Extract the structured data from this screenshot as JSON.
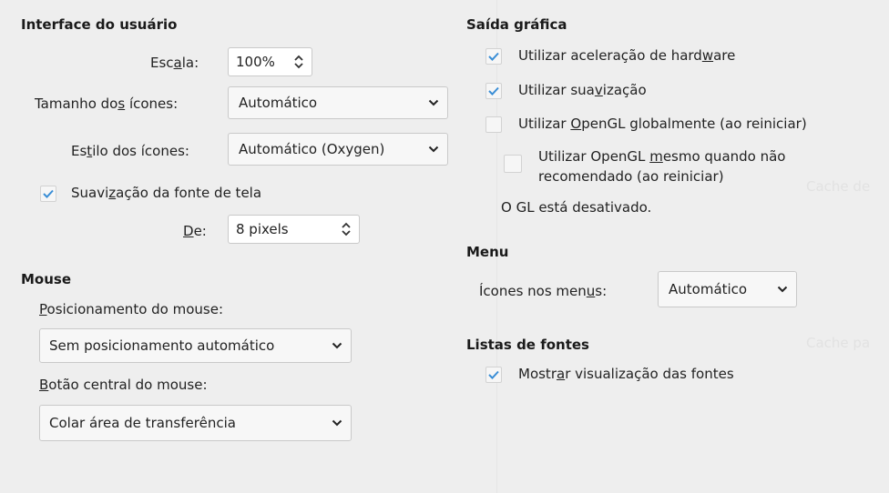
{
  "ui": {
    "title": "Interface do usuário",
    "scale_label_a": "Esc",
    "scale_label_u": "a",
    "scale_label_b": "la:",
    "scale_value": "100%",
    "icon_size_label_a": "Tamanho do",
    "icon_size_label_u": "s",
    "icon_size_label_b": " ícones:",
    "icon_size_value": "Automático",
    "icon_style_label_a": "Es",
    "icon_style_label_u": "t",
    "icon_style_label_b": "ilo dos ícones:",
    "icon_style_value": "Automático (Oxygen)",
    "smoothing_label_a": "Suavi",
    "smoothing_label_u": "z",
    "smoothing_label_b": "ação da fonte de tela",
    "from_label_u": "D",
    "from_label_b": "e:",
    "from_value": "8 pixels"
  },
  "mouse": {
    "title": "Mouse",
    "positioning_label_u": "P",
    "positioning_label_b": "osicionamento do mouse:",
    "positioning_value": "Sem posicionamento automático",
    "middle_label_u": "B",
    "middle_label_b": "otão central do mouse:",
    "middle_value": "Colar área de transferência"
  },
  "graphics": {
    "title": "Saída gráfica",
    "hw_a": "Utilizar aceleração de hard",
    "hw_u": "w",
    "hw_b": "are",
    "aa_a": "Utilizar sua",
    "aa_u": "v",
    "aa_b": "ização",
    "ogl_a": "Utilizar ",
    "ogl_u": "O",
    "ogl_b": "penGL globalmente (ao reiniciar)",
    "ogl_force_a": "Utilizar OpenGL ",
    "ogl_force_u": "m",
    "ogl_force_b": "esmo quando não",
    "ogl_force_line2": "recomendado (ao reiniciar)",
    "gl_status": "O GL está desativado."
  },
  "menu": {
    "title": "Menu",
    "icons_label_a": "Ícones nos men",
    "icons_label_u": "u",
    "icons_label_b": "s:",
    "icons_value": "Automático"
  },
  "fonts": {
    "title": "Listas de fontes",
    "preview_a": "Mostr",
    "preview_u": "a",
    "preview_b": "r visualização das fontes"
  },
  "checks": {
    "smoothing": true,
    "hw": true,
    "aa": true,
    "ogl": false,
    "ogl_force": false,
    "preview": true
  },
  "colors": {
    "check": "#3a8ed6",
    "accent_bg": "#eeeeee"
  }
}
